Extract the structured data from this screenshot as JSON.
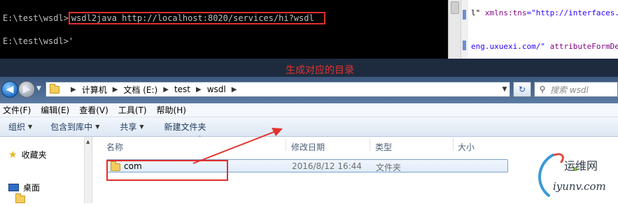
{
  "console": {
    "partial_line": "──── ──",
    "prompt1": "E:\\test\\wsdl>",
    "command": "wsdl2java http://localhost:8020/services/hi?wsdl",
    "prompt2": "E:\\test\\wsdl>'"
  },
  "xml_pane": {
    "line1_a": "l\"",
    "line1_attr": "xmlns:tns",
    "line1_val": "=\"http://interfaces.",
    "line2_a": "eng.uxuexi.com/\"",
    "line2_attr": "attributeFormDef"
  },
  "explorer": {
    "breadcrumbs": [
      "计算机",
      "文档 (E:)",
      "test",
      "wsdl"
    ],
    "search_placeholder": "搜索 wsdl",
    "menu": [
      "文件(F)",
      "编辑(E)",
      "查看(V)",
      "工具(T)",
      "帮助(H)"
    ],
    "toolbar": {
      "organize": "组织",
      "include_library": "包含到库中",
      "share": "共享",
      "new_folder": "新建文件夹"
    },
    "nav": {
      "favorites": "收藏夹",
      "desktop": "桌面"
    },
    "columns": {
      "name": "名称",
      "modified": "修改日期",
      "type": "类型",
      "size": "大小"
    },
    "files": [
      {
        "name": "com",
        "modified": "2016/8/12 16:44",
        "type": "文件夹",
        "size": ""
      }
    ]
  },
  "annotation": {
    "text": "生成对应的目录",
    "color": "#e2332e"
  },
  "watermark": {
    "cn": "运维网",
    "en": "iyunv.com"
  }
}
